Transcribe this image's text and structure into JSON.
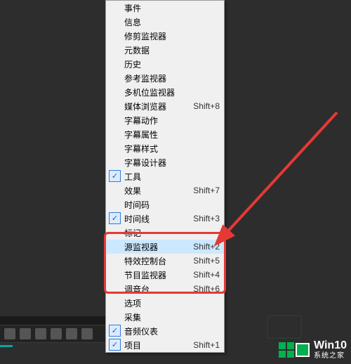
{
  "menu": {
    "items": [
      {
        "label": "事件",
        "shortcut": "",
        "checked": false
      },
      {
        "label": "信息",
        "shortcut": "",
        "checked": false
      },
      {
        "label": "修剪监视器",
        "shortcut": "",
        "checked": false
      },
      {
        "label": "元数据",
        "shortcut": "",
        "checked": false
      },
      {
        "label": "历史",
        "shortcut": "",
        "checked": false
      },
      {
        "label": "参考监视器",
        "shortcut": "",
        "checked": false
      },
      {
        "label": "多机位监视器",
        "shortcut": "",
        "checked": false
      },
      {
        "label": "媒体浏览器",
        "shortcut": "Shift+8",
        "checked": false
      },
      {
        "label": "字幕动作",
        "shortcut": "",
        "checked": false
      },
      {
        "label": "字幕属性",
        "shortcut": "",
        "checked": false
      },
      {
        "label": "字幕样式",
        "shortcut": "",
        "checked": false
      },
      {
        "label": "字幕设计器",
        "shortcut": "",
        "checked": false
      },
      {
        "label": "工具",
        "shortcut": "",
        "checked": true
      },
      {
        "label": "效果",
        "shortcut": "Shift+7",
        "checked": false
      },
      {
        "label": "时间码",
        "shortcut": "",
        "checked": false
      },
      {
        "label": "时间线",
        "shortcut": "Shift+3",
        "checked": true
      },
      {
        "label": "标记",
        "shortcut": "",
        "checked": false
      },
      {
        "label": "源监视器",
        "shortcut": "Shift+2",
        "checked": false,
        "hovered": true
      },
      {
        "label": "特效控制台",
        "shortcut": "Shift+5",
        "checked": false
      },
      {
        "label": "节目监视器",
        "shortcut": "Shift+4",
        "checked": false
      },
      {
        "label": "调音台",
        "shortcut": "Shift+6",
        "checked": false
      },
      {
        "label": "选项",
        "shortcut": "",
        "checked": false
      },
      {
        "label": "采集",
        "shortcut": "",
        "checked": false
      },
      {
        "label": "音频仪表",
        "shortcut": "",
        "checked": true
      },
      {
        "label": "项目",
        "shortcut": "Shift+1",
        "checked": true
      }
    ]
  },
  "watermark": {
    "title": "Win10",
    "subtitle": "系统之家"
  },
  "colors": {
    "highlight": "#e53935",
    "arrow": "#e53935",
    "menuBg": "#f0f0f0",
    "checkBorder": "#2a7de1"
  }
}
